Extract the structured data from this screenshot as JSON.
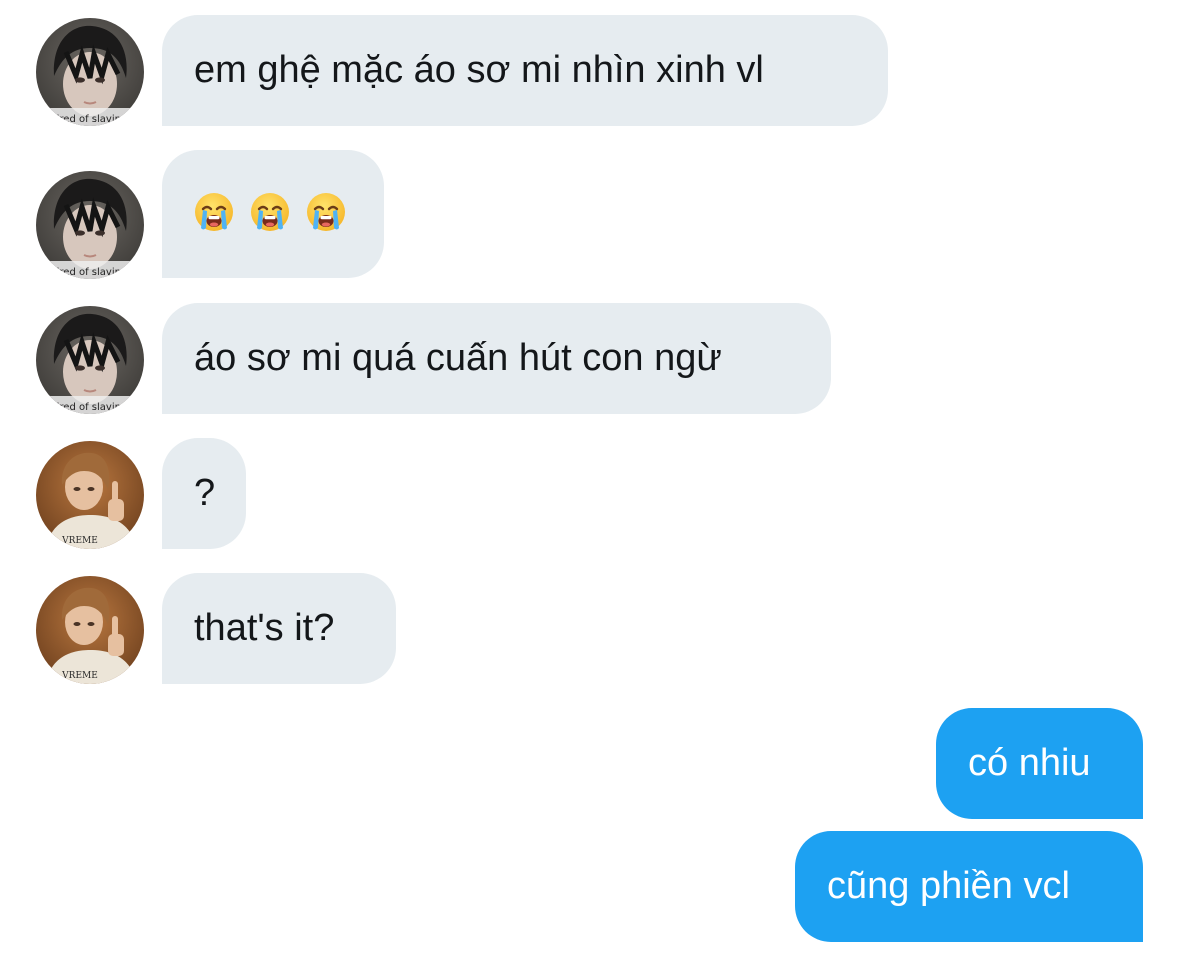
{
  "messages": [
    {
      "sender": "other",
      "avatar": "dark-hair-avatar",
      "text": "em ghệ mặc áo sơ mi nhìn xinh vl"
    },
    {
      "sender": "other",
      "avatar": "dark-hair-avatar",
      "emoji": [
        "loudly-crying-face",
        "loudly-crying-face",
        "loudly-crying-face"
      ]
    },
    {
      "sender": "other",
      "avatar": "dark-hair-avatar",
      "text": "áo sơ mi quá cuấn hút con ngừ"
    },
    {
      "sender": "other",
      "avatar": "light-hair-avatar",
      "text": "?"
    },
    {
      "sender": "other",
      "avatar": "light-hair-avatar",
      "text": "that's it?"
    },
    {
      "sender": "me",
      "text": "có nhiu"
    },
    {
      "sender": "me",
      "text": "cũng phiền vcl"
    }
  ],
  "avatar_caption": "tired of slaving",
  "colors": {
    "incoming_bubble": "#e6ecf0",
    "incoming_text": "#14171a",
    "outgoing_bubble": "#1da1f2",
    "outgoing_text": "#ffffff",
    "background": "#ffffff"
  }
}
